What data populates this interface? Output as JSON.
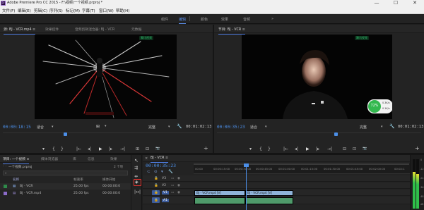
{
  "app": {
    "title": "Adobe Premiere Pro CC 2015 - F:\\视频\\一个视频.prproj *",
    "window_controls": {
      "minimize": "—",
      "maximize": "☐",
      "close": "✕"
    }
  },
  "menu": [
    "文件(F)",
    "编辑(E)",
    "剪辑(C)",
    "序列(S)",
    "标记(M)",
    "字幕(T)",
    "窗口(W)",
    "帮助(H)"
  ],
  "workspaces": {
    "items": [
      "组件",
      "编辑",
      "颜色",
      "效果",
      "音频"
    ],
    "active": "编辑",
    "more": "»"
  },
  "source_panel": {
    "tabs": [
      "源: BJ - VCR.mp4 ≡",
      "效果控件",
      "音频剪辑混合器: BJ - VCR",
      "元数据"
    ],
    "timecode": "00:00:18:15",
    "fit": "适合",
    "duration": "00:01:02:13",
    "controls": [
      "▾",
      "{",
      "}",
      "|←",
      "◂|",
      "▶",
      "|▸",
      "→|",
      "⊞",
      "⊟",
      "📷"
    ]
  },
  "program_panel": {
    "tabs": [
      "节目: BJ - VCR ≡"
    ],
    "timecode": "00:00:35:23",
    "fit": "适合",
    "quality": "完整",
    "duration": "00:01:02:13",
    "controls": [
      "▾",
      "{",
      "}",
      "|←",
      "◂|",
      "▶",
      "|▸",
      "→|",
      "⊟",
      "⊡",
      "📷"
    ],
    "network_widget": {
      "percent": "72%",
      "up": "0.3K/s",
      "down": "0.1K/s"
    },
    "watermark": "腾讯视频"
  },
  "project_panel": {
    "tabs": [
      "项目: 一个视频 ≡",
      "媒体浏览器",
      "库",
      "信息",
      "效果",
      "标记"
    ],
    "project_file": "一个视频.prproj",
    "item_count": "2 个项",
    "columns": [
      "名称",
      "帧速率",
      "媒体开始"
    ],
    "rows": [
      {
        "name": "BJ - VCR",
        "fps": "25.00 fps",
        "start": "00:00:00:0"
      },
      {
        "name": "BJ - VCR.mp4",
        "fps": "25.00 fps",
        "start": "00:00:00:0"
      }
    ]
  },
  "timeline": {
    "tab": "BJ - VCR ≡",
    "timecode": "00:00:35:23",
    "ruler_labels": [
      "00:00",
      "00:00:15:00",
      "00:00:30:00",
      "00:00:45:00",
      "00:01:00:00",
      "00:01:15:00",
      "00:01:30:00",
      "00:01:45:00",
      "00:02:00:00",
      "00:02:1"
    ],
    "tracks": [
      {
        "id": "V3",
        "kind": "video"
      },
      {
        "id": "V2",
        "kind": "video"
      },
      {
        "id": "V1",
        "kind": "video"
      },
      {
        "id": "A1",
        "kind": "audio"
      }
    ],
    "clips": [
      {
        "label": "BJ - VCR.mp4 [V]",
        "track": "V1"
      },
      {
        "label": "BJ - VCR.mp4 [V]",
        "track": "V1"
      },
      {
        "label": "",
        "track": "A1"
      },
      {
        "label": "",
        "track": "A1"
      }
    ]
  },
  "audio_meter": {
    "labels": [
      "0",
      "-12",
      "-24",
      "-36",
      "-48",
      "dB"
    ]
  },
  "colors": {
    "accent": "#4c8fe8",
    "clip_video": "#8fb3d9",
    "clip_audio": "#4f9a6a",
    "highlight": "#e8332e"
  }
}
